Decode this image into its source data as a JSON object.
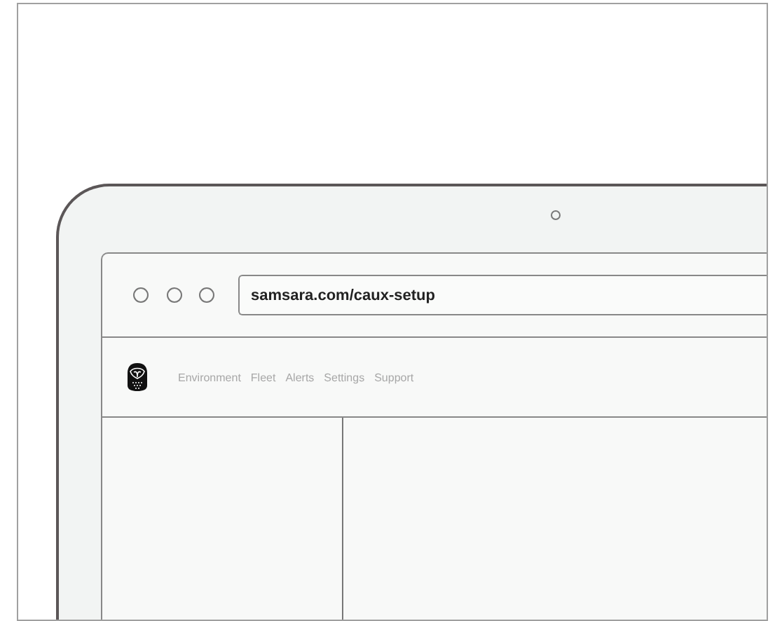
{
  "browser": {
    "address": "samsara.com/caux-setup"
  },
  "nav": {
    "items": [
      "Environment",
      "Fleet",
      "Alerts",
      "Settings",
      "Support"
    ]
  }
}
